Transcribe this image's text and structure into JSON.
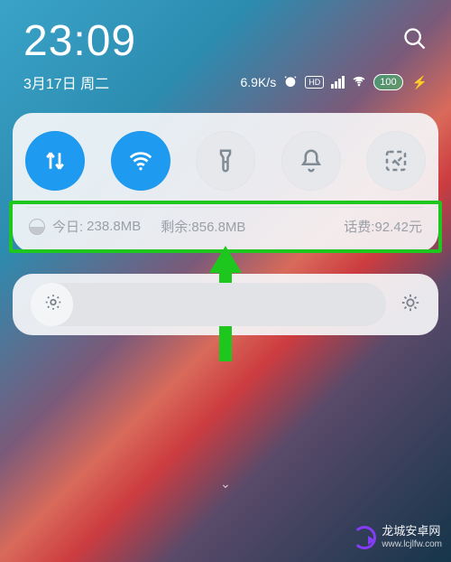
{
  "status": {
    "time": "23:09",
    "date": "3月17日 周二",
    "net_speed": "6.9K/s",
    "hd_label": "HD",
    "battery_level": "100",
    "charging_glyph": "⚡"
  },
  "quick_toggles": {
    "data": {
      "name": "mobile-data",
      "active": true
    },
    "wifi": {
      "name": "wifi",
      "active": true
    },
    "flashlight": {
      "name": "flashlight",
      "active": false
    },
    "dnd": {
      "name": "silent",
      "active": false
    },
    "screenshot": {
      "name": "screenshot",
      "active": false
    }
  },
  "data_usage": {
    "today_label": "今日:",
    "today_value": "238.8MB",
    "remaining_label": "剩余:",
    "remaining_value": "856.8MB",
    "balance_label": "话费:",
    "balance_value": "92.42元"
  },
  "brightness": {
    "percent": 12
  },
  "watermark": {
    "title": "龙城安卓网",
    "subtitle": "www.lcjlfw.com"
  },
  "highlight_color": "#1ec71e",
  "accent_color": "#1e9bf0"
}
